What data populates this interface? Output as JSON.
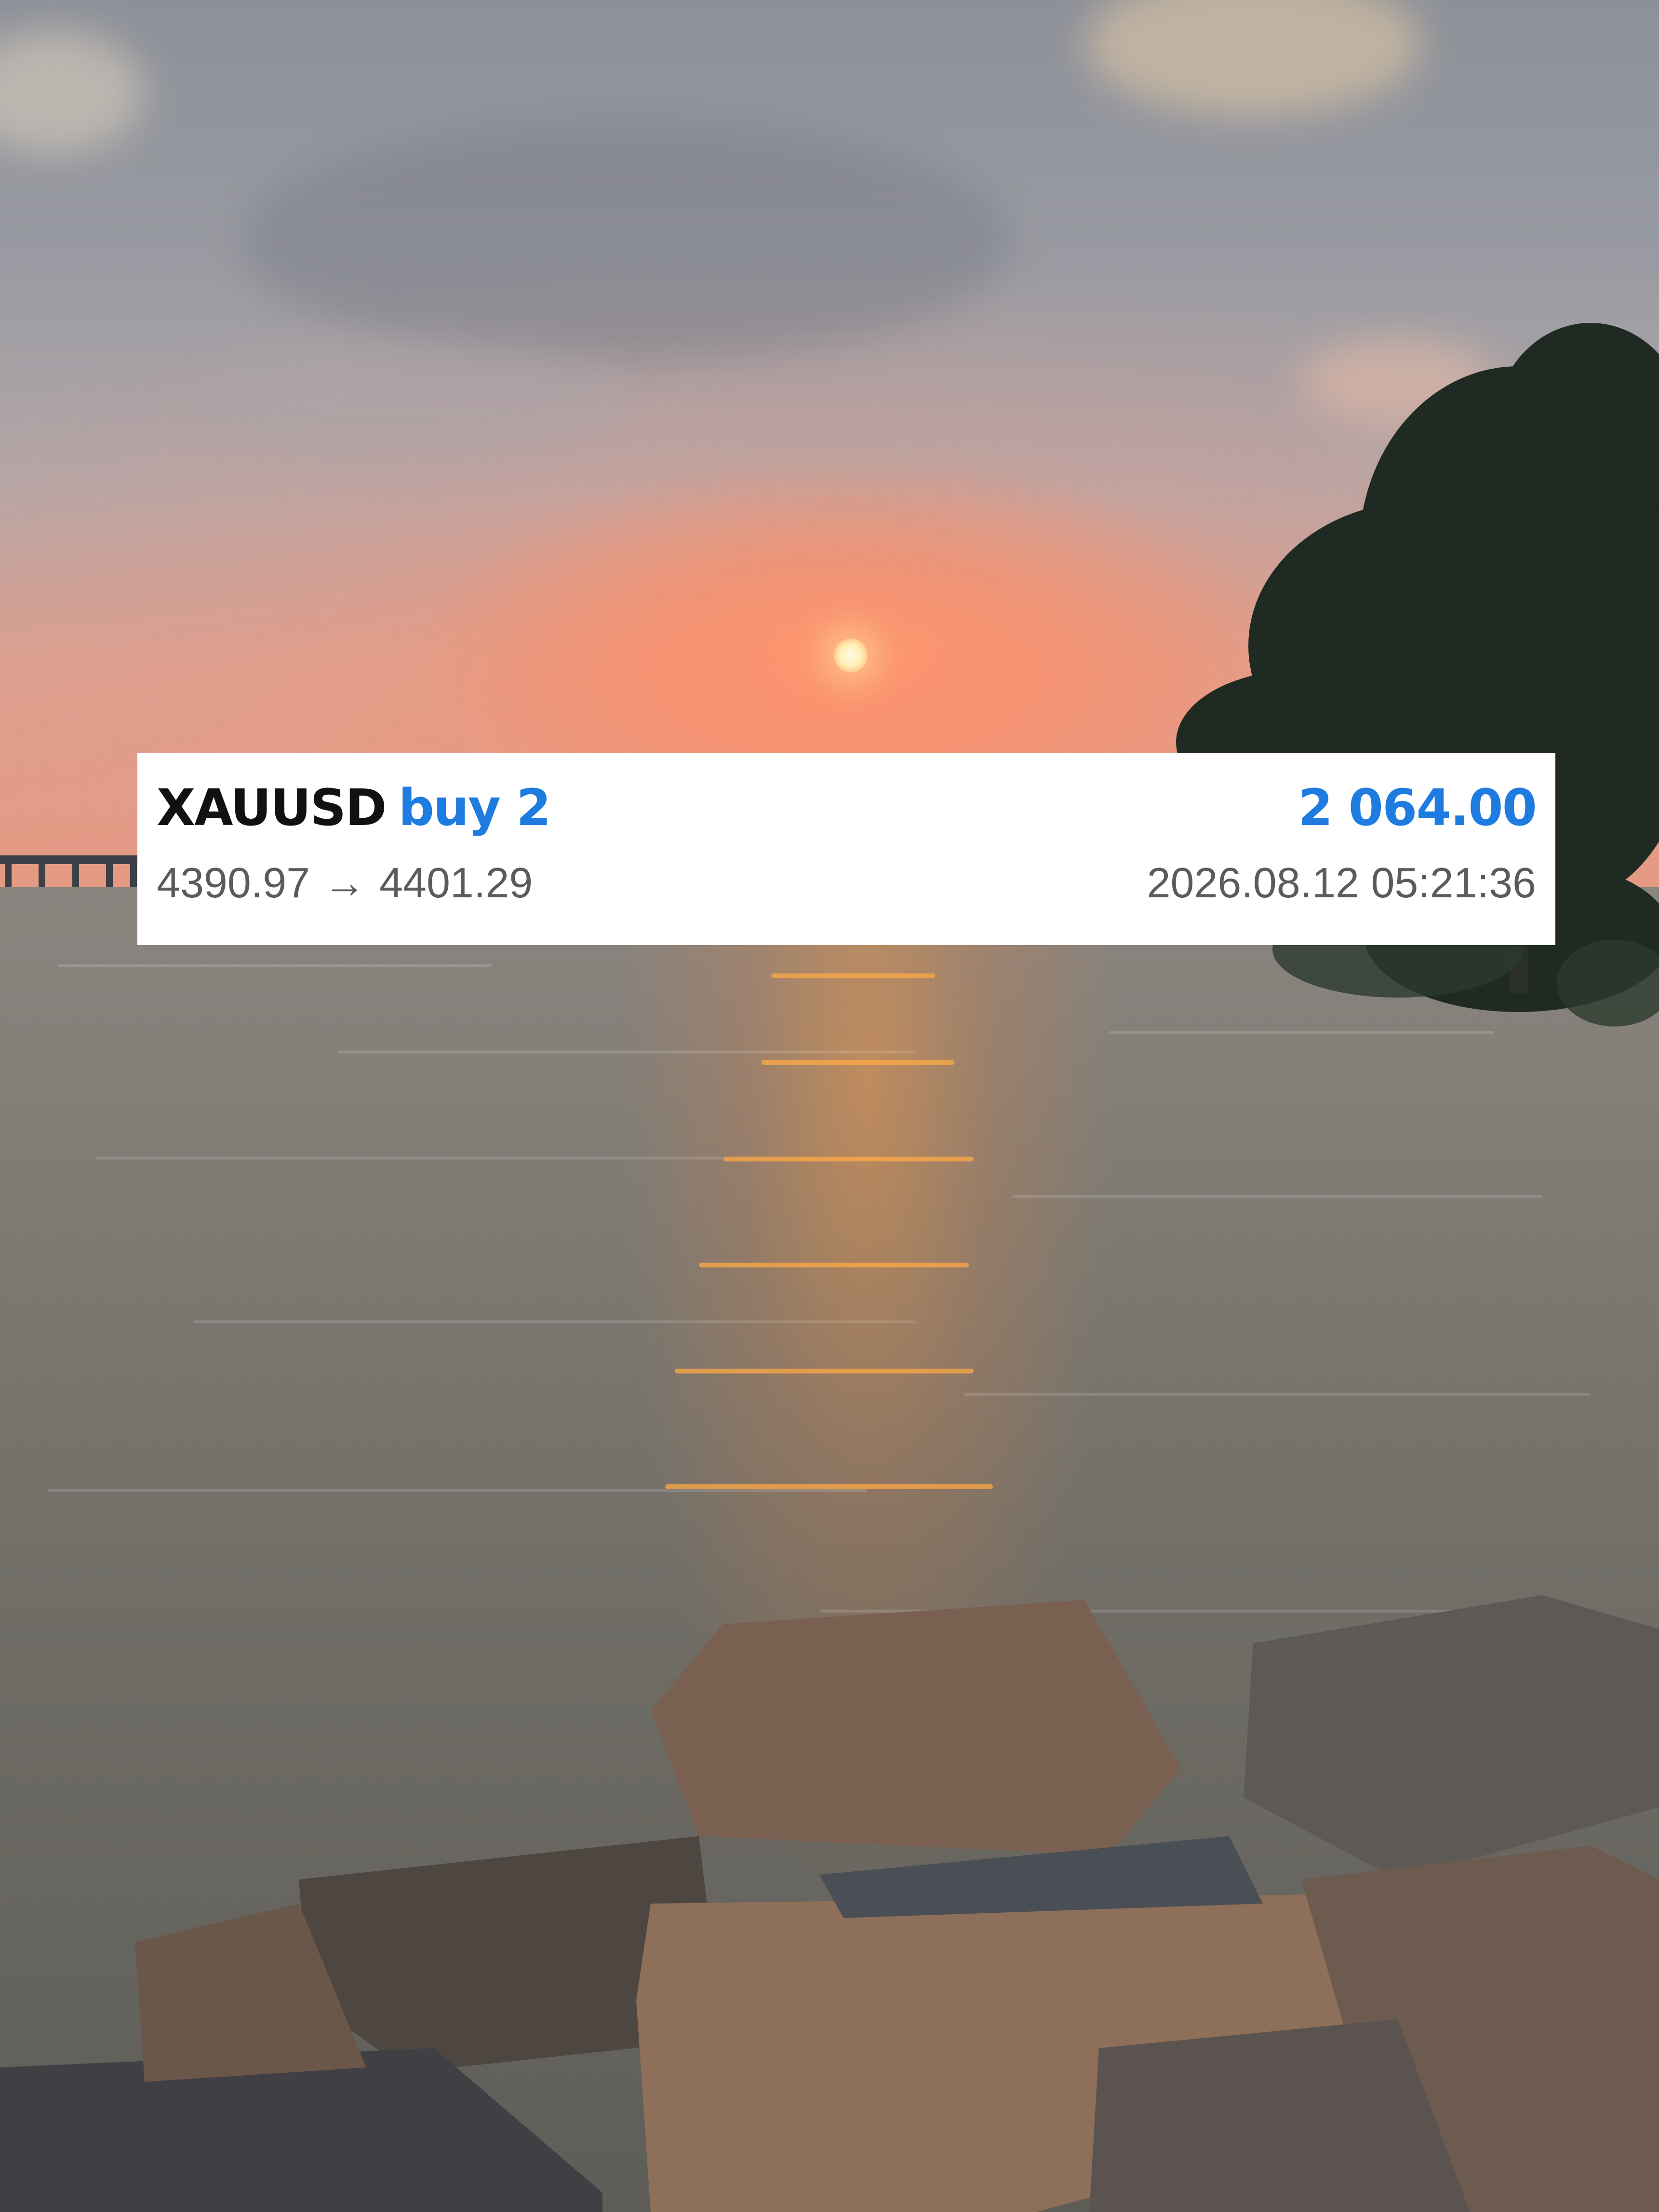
{
  "trade": {
    "symbol": "XAUUSD",
    "direction": "buy 2",
    "open_price": "4390.97",
    "arrow": "→",
    "close_price": "4401.29",
    "profit": "2 064.00",
    "timestamp": "2026.08.12 05:21:36"
  },
  "colors": {
    "profit": "#1e7be0",
    "direction": "#1e7be0",
    "symbol": "#111111",
    "secondary_text": "#5b5b5b",
    "card_background": "#ffffff"
  }
}
